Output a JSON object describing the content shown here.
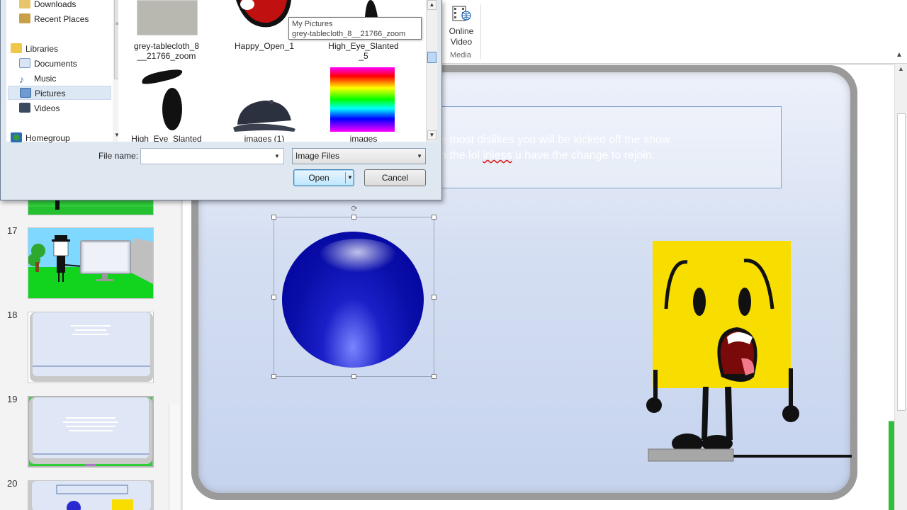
{
  "colors": {
    "dialog_bg": "#dfe7f1",
    "slide_gradient_top": "#eef2fb",
    "ball_blue": "#0a0ea8",
    "character_yellow": "#f7dd00",
    "open_button_border": "#3c7fb1"
  },
  "ribbon": {
    "online_video_line1": "Online",
    "online_video_line2": "Video",
    "group_label": "Media"
  },
  "dialog": {
    "nav_items": [
      {
        "label": "Downloads",
        "icon": "folder-icon"
      },
      {
        "label": "Recent Places",
        "icon": "recent-places-icon"
      },
      {
        "label": "Libraries",
        "icon": "library-icon"
      },
      {
        "label": "Documents",
        "icon": "documents-icon"
      },
      {
        "label": "Music",
        "icon": "music-icon"
      },
      {
        "label": "Pictures",
        "icon": "pictures-icon",
        "selected": true
      },
      {
        "label": "Videos",
        "icon": "videos-icon"
      },
      {
        "label": "Homegroup",
        "icon": "homegroup-icon"
      }
    ],
    "files": [
      {
        "line1": "grey-tablecloth_8",
        "line2": "__21766_zoom"
      },
      {
        "line1": "Happy_Open_1",
        "line2": ""
      },
      {
        "line1": "High_Eye_Slanted",
        "line2": "_5"
      },
      {
        "line1": "High_Eye_Slanted",
        "line2": ""
      },
      {
        "line1": "images (1)",
        "line2": ""
      },
      {
        "line1": "images",
        "line2": ""
      }
    ],
    "tooltip": {
      "line1": "My Pictures",
      "line2": "grey-tablecloth_8__21766_zoom"
    },
    "file_name_label": "File name:",
    "file_name_value": "",
    "file_type_selected": "Image Files",
    "open_label": "Open",
    "cancel_label": "Cancel"
  },
  "slides": {
    "numbers": [
      "17",
      "18",
      "19",
      "20"
    ]
  },
  "slide_text": {
    "line1": "e most dislikes you will be kicked off the show",
    "line2_a": "n the lol ",
    "line2_misspelled": "inless",
    "line2_b": " u have the change to rejoin."
  }
}
